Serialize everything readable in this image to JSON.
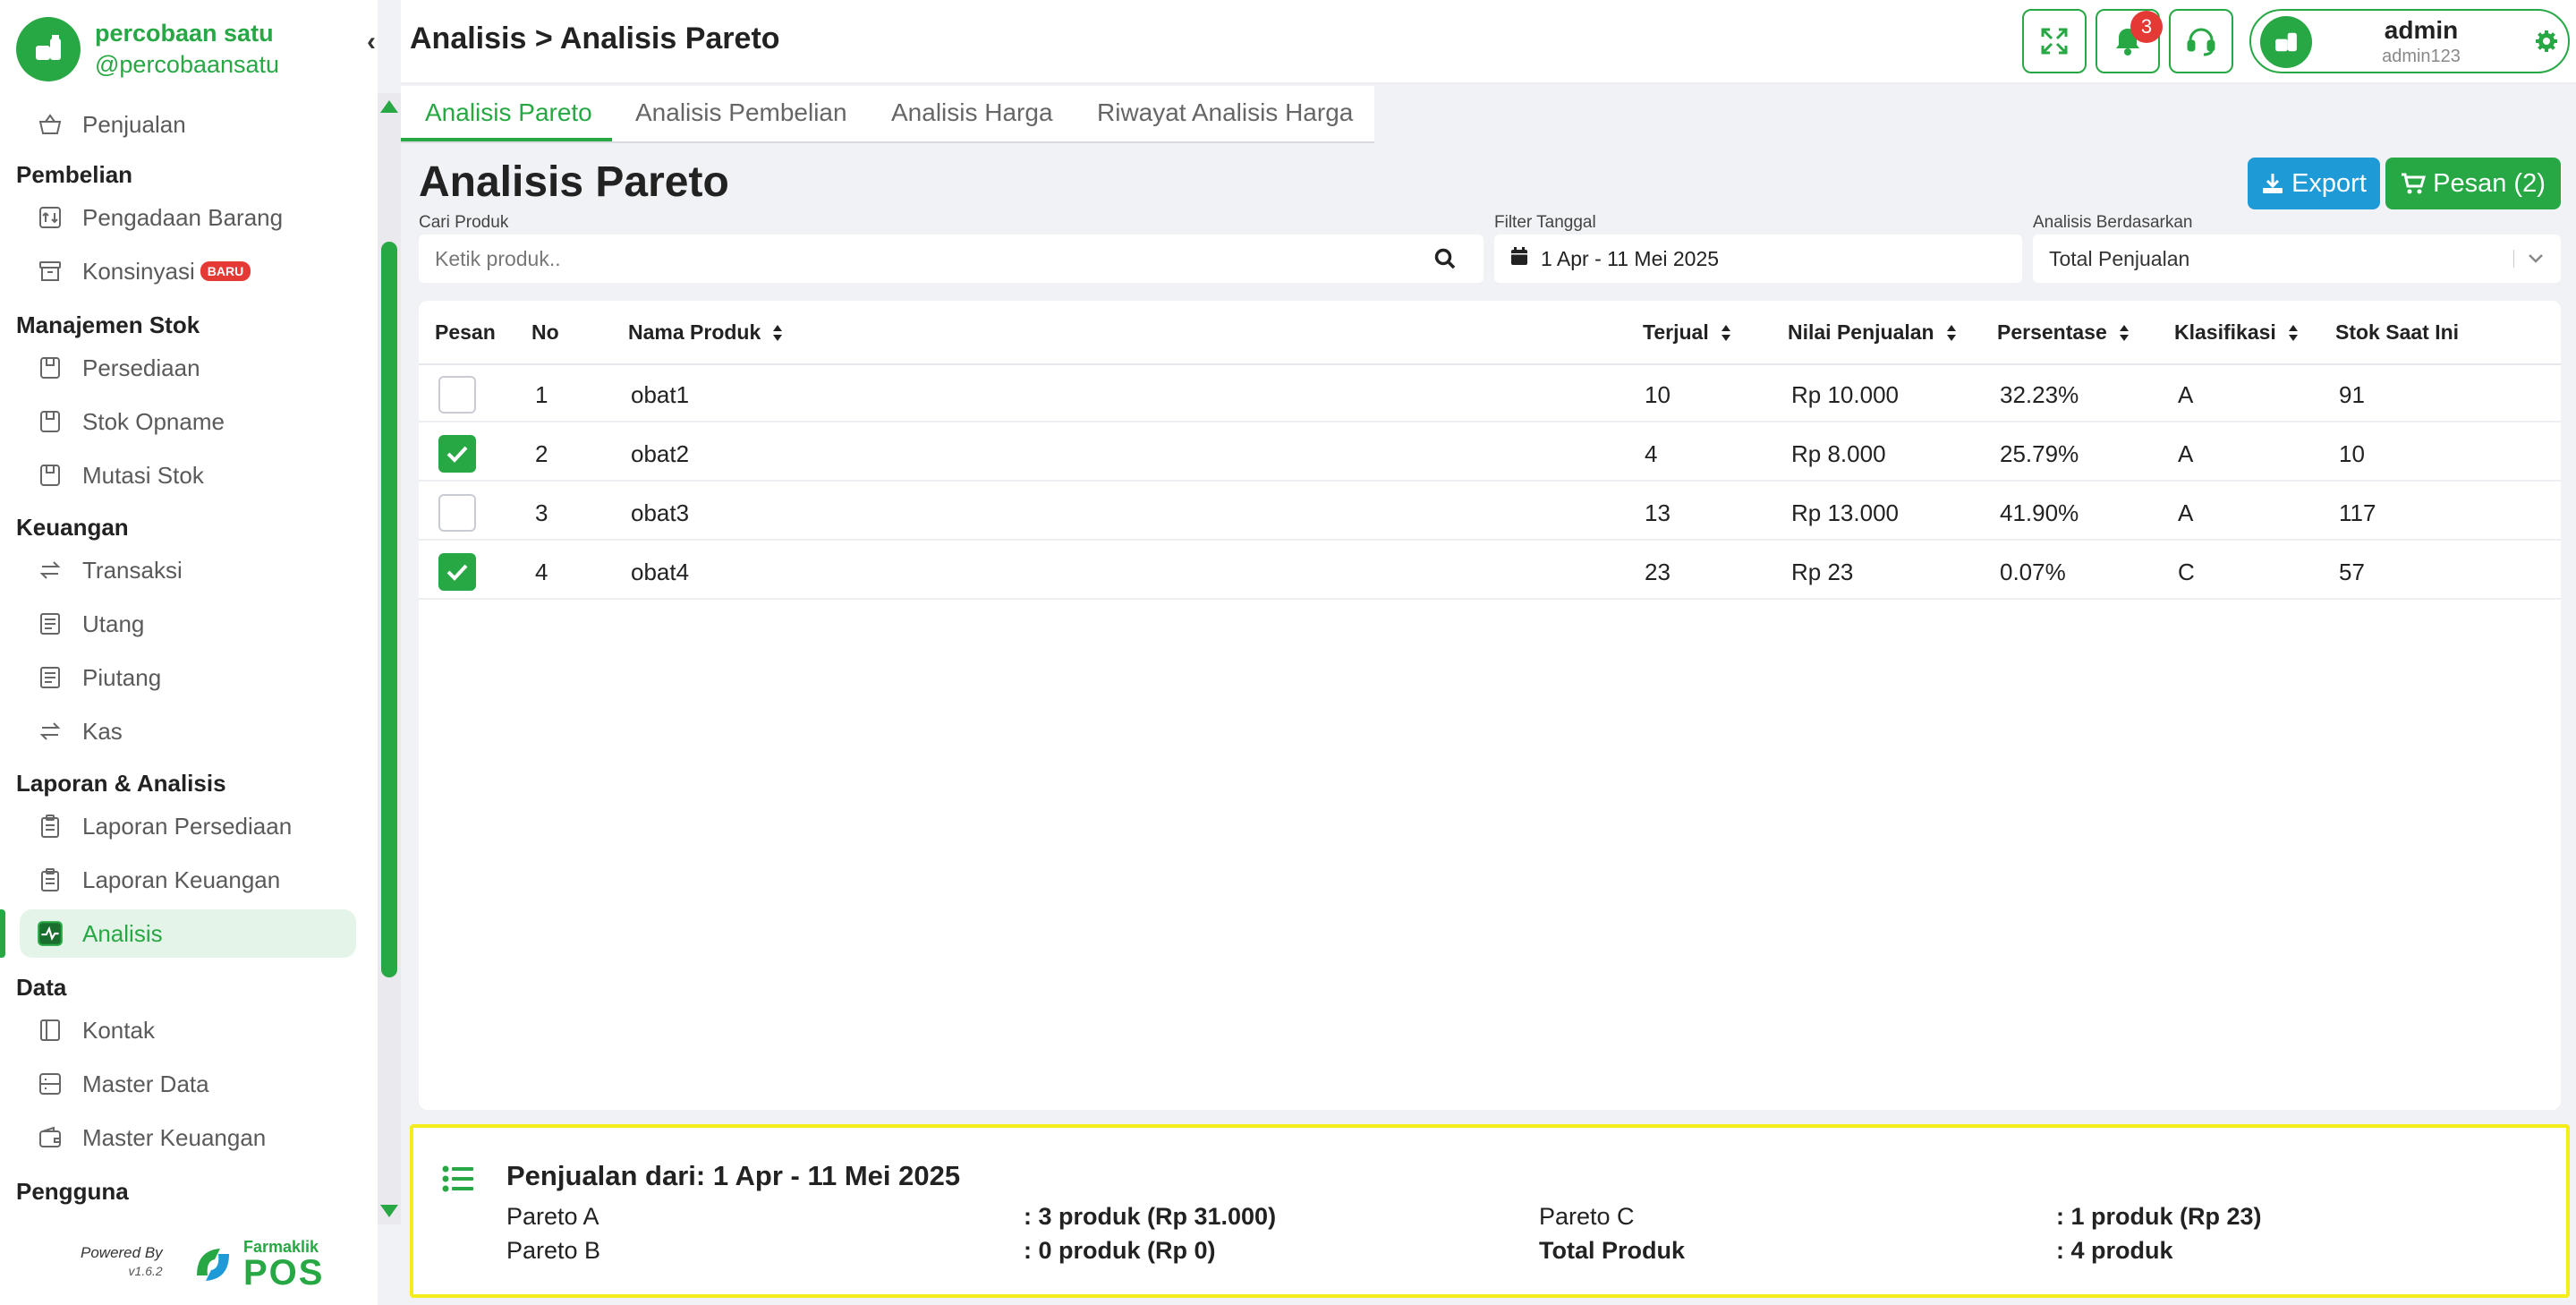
{
  "brand": {
    "name": "percobaan satu",
    "handle": "@percobaansatu"
  },
  "sidebar": {
    "items": [
      {
        "label": "Penjualan"
      },
      {
        "section": "Pembelian"
      },
      {
        "label": "Pengadaan Barang"
      },
      {
        "label": "Konsinyasi",
        "badge": "BARU"
      },
      {
        "section": "Manajemen Stok"
      },
      {
        "label": "Persediaan"
      },
      {
        "label": "Stok Opname"
      },
      {
        "label": "Mutasi Stok"
      },
      {
        "section": "Keuangan"
      },
      {
        "label": "Transaksi"
      },
      {
        "label": "Utang"
      },
      {
        "label": "Piutang"
      },
      {
        "label": "Kas"
      },
      {
        "section": "Laporan & Analisis"
      },
      {
        "label": "Laporan Persediaan"
      },
      {
        "label": "Laporan Keuangan"
      },
      {
        "label": "Analisis",
        "active": true
      },
      {
        "section": "Data"
      },
      {
        "label": "Kontak"
      },
      {
        "label": "Master Data"
      },
      {
        "label": "Master Keuangan"
      },
      {
        "section": "Pengguna"
      }
    ],
    "powered_by": "Powered By",
    "version": "v1.6.2",
    "pos_brand_top": "Farmaklik",
    "pos_brand_main": "POS"
  },
  "header": {
    "breadcrumb": "Analisis > Analisis Pareto",
    "notification_count": "3",
    "user": {
      "name": "admin",
      "role": "admin123"
    }
  },
  "tabs": [
    "Analisis Pareto",
    "Analisis Pembelian",
    "Analisis Harga",
    "Riwayat Analisis Harga"
  ],
  "main": {
    "title": "Analisis Pareto",
    "export_label": "Export",
    "pesan_label": "Pesan (2)",
    "search": {
      "label": "Cari Produk",
      "placeholder": "Ketik produk.."
    },
    "date_filter": {
      "label": "Filter Tanggal",
      "value": "1 Apr - 11 Mei 2025"
    },
    "analysis_by": {
      "label": "Analisis Berdasarkan",
      "value": "Total Penjualan"
    }
  },
  "table": {
    "columns": [
      "Pesan",
      "No",
      "Nama Produk",
      "Terjual",
      "Nilai Penjualan",
      "Persentase",
      "Klasifikasi",
      "Stok Saat Ini"
    ],
    "rows": [
      {
        "checked": false,
        "no": "1",
        "name": "obat1",
        "sold": "10",
        "value": "Rp 10.000",
        "percent": "32.23%",
        "class": "A",
        "stock": "91"
      },
      {
        "checked": true,
        "no": "2",
        "name": "obat2",
        "sold": "4",
        "value": "Rp 8.000",
        "percent": "25.79%",
        "class": "A",
        "stock": "10"
      },
      {
        "checked": false,
        "no": "3",
        "name": "obat3",
        "sold": "13",
        "value": "Rp 13.000",
        "percent": "41.90%",
        "class": "A",
        "stock": "117"
      },
      {
        "checked": true,
        "no": "4",
        "name": "obat4",
        "sold": "23",
        "value": "Rp 23",
        "percent": "0.07%",
        "class": "C",
        "stock": "57"
      }
    ]
  },
  "summary": {
    "title": "Penjualan dari: 1 Apr - 11 Mei 2025",
    "pareto_a_label": "Pareto A",
    "pareto_a_value": ": 3 produk (Rp 31.000)",
    "pareto_b_label": "Pareto B",
    "pareto_b_value": ": 0 produk (Rp 0)",
    "pareto_c_label": "Pareto C",
    "pareto_c_value": ": 1 produk (Rp 23)",
    "total_label": "Total Produk",
    "total_value": ": 4 produk"
  },
  "colors": {
    "brand_green": "#27a844",
    "export_blue": "#1e9ad6",
    "badge_red": "#e53935",
    "highlight_yellow": "#f5ec1c"
  }
}
